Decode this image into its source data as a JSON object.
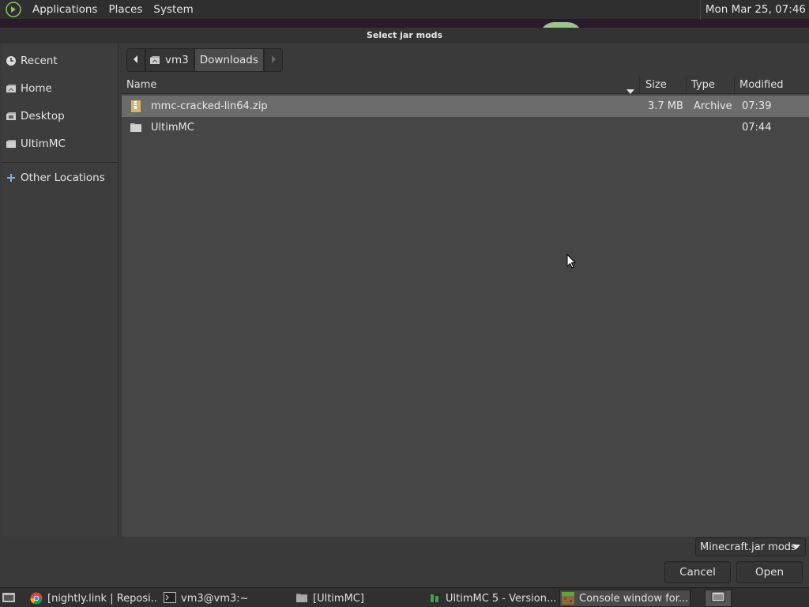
{
  "top_panel": {
    "menus": [
      "Applications",
      "Places",
      "System"
    ],
    "clock": "Mon Mar 25, 07:46"
  },
  "dialog": {
    "title": "Select jar mods",
    "sidebar": {
      "items": [
        {
          "label": "Recent",
          "icon": "recent-icon"
        },
        {
          "label": "Home",
          "icon": "home-icon"
        },
        {
          "label": "Desktop",
          "icon": "desktop-icon"
        },
        {
          "label": "UltimMC",
          "icon": "folder-icon"
        },
        {
          "label": "Other Locations",
          "icon": "plus-icon"
        }
      ]
    },
    "pathbar": {
      "segments": [
        "vm3",
        "Downloads"
      ]
    },
    "columns": {
      "name": "Name",
      "size": "Size",
      "type": "Type",
      "modified": "Modified"
    },
    "files": [
      {
        "name": "mmc-cracked-lin64.zip",
        "size": "3.7 MB",
        "type": "Archive",
        "modified": "07:39",
        "icon": "archive-icon",
        "selected": true
      },
      {
        "name": "UltimMC",
        "size": "",
        "type": "",
        "modified": "07:44",
        "icon": "folder-icon",
        "selected": false
      }
    ],
    "filter": "Minecraft.jar mods",
    "buttons": {
      "cancel": "Cancel",
      "open": "Open"
    }
  },
  "taskbar": {
    "tasks": [
      {
        "label": "[nightly.link | Reposi...",
        "icon": "chrome-icon"
      },
      {
        "label": "vm3@vm3:~",
        "icon": "terminal-icon"
      },
      {
        "label": "[UltimMC]",
        "icon": "folder-icon"
      },
      {
        "label": "UltimMC 5 - Version...",
        "icon": "ultimmc-icon"
      },
      {
        "label": "Console window for...",
        "icon": "minecraft-icon",
        "active": true
      }
    ]
  }
}
